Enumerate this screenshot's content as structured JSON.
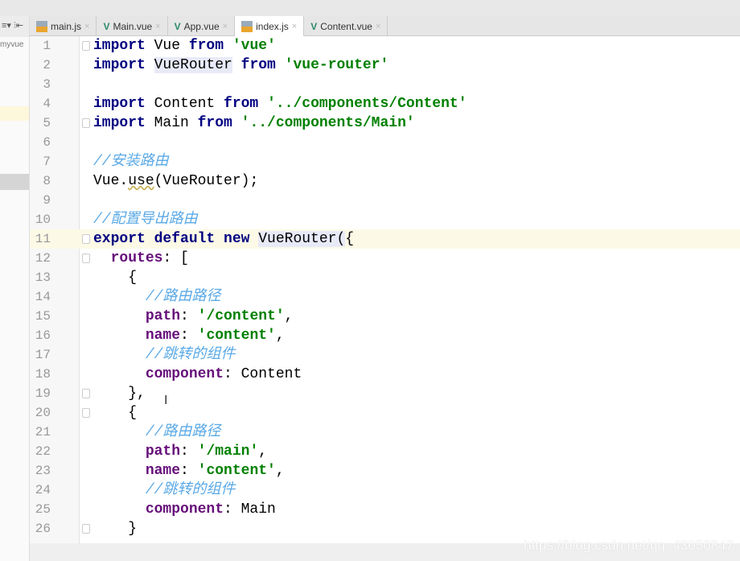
{
  "sidebar": {
    "toolbar": "≡▾ ⫶⇤",
    "project": "myvue"
  },
  "tabs": [
    {
      "label": "main.js",
      "icon": "js-file-icon",
      "active": false
    },
    {
      "label": "Main.vue",
      "icon": "vue-icon",
      "active": false
    },
    {
      "label": "App.vue",
      "icon": "vue-icon",
      "active": false
    },
    {
      "label": "index.js",
      "icon": "js-file-icon",
      "active": true
    },
    {
      "label": "Content.vue",
      "icon": "vue-icon",
      "active": false
    }
  ],
  "close_glyph": "×",
  "current_line": 11,
  "lines": [
    [
      [
        "kw",
        "import"
      ],
      [
        "t",
        " Vue "
      ],
      [
        "kw",
        "from"
      ],
      [
        "t",
        " "
      ],
      [
        "str",
        "'vue'"
      ]
    ],
    [
      [
        "kw",
        "import"
      ],
      [
        "t",
        " "
      ],
      [
        "hl",
        "VueRouter"
      ],
      [
        "t",
        " "
      ],
      [
        "kw",
        "from"
      ],
      [
        "t",
        " "
      ],
      [
        "str",
        "'vue-router'"
      ]
    ],
    [],
    [
      [
        "kw",
        "import"
      ],
      [
        "t",
        " Content "
      ],
      [
        "kw",
        "from"
      ],
      [
        "t",
        " "
      ],
      [
        "str",
        "'../components/Content'"
      ]
    ],
    [
      [
        "kw",
        "import"
      ],
      [
        "t",
        " Main "
      ],
      [
        "kw",
        "from"
      ],
      [
        "t",
        " "
      ],
      [
        "str",
        "'../components/Main'"
      ]
    ],
    [],
    [
      [
        "cm",
        "//安装路由"
      ]
    ],
    [
      [
        "t",
        "Vue."
      ],
      [
        "warn",
        "use"
      ],
      [
        "t",
        "(VueRouter);"
      ]
    ],
    [],
    [
      [
        "cm",
        "//配置导出路由"
      ]
    ],
    [
      [
        "kw",
        "export default new"
      ],
      [
        "t",
        " "
      ],
      [
        "hl",
        "VueRouter"
      ],
      [
        "hl",
        "("
      ],
      [
        "t",
        "{"
      ]
    ],
    [
      [
        "t",
        "  "
      ],
      [
        "prop",
        "routes"
      ],
      [
        "t",
        ": ["
      ]
    ],
    [
      [
        "t",
        "    {"
      ]
    ],
    [
      [
        "t",
        "      "
      ],
      [
        "cm",
        "//路由路径"
      ]
    ],
    [
      [
        "t",
        "      "
      ],
      [
        "prop",
        "path"
      ],
      [
        "t",
        ": "
      ],
      [
        "str",
        "'/content'"
      ],
      [
        "t",
        ","
      ]
    ],
    [
      [
        "t",
        "      "
      ],
      [
        "prop",
        "name"
      ],
      [
        "t",
        ": "
      ],
      [
        "str",
        "'content'"
      ],
      [
        "t",
        ","
      ]
    ],
    [
      [
        "t",
        "      "
      ],
      [
        "cm",
        "//跳转的组件"
      ]
    ],
    [
      [
        "t",
        "      "
      ],
      [
        "prop",
        "component"
      ],
      [
        "t",
        ": Content"
      ]
    ],
    [
      [
        "t",
        "    },"
      ]
    ],
    [
      [
        "t",
        "    {"
      ]
    ],
    [
      [
        "t",
        "      "
      ],
      [
        "cm",
        "//路由路径"
      ]
    ],
    [
      [
        "t",
        "      "
      ],
      [
        "prop",
        "path"
      ],
      [
        "t",
        ": "
      ],
      [
        "str",
        "'/main'"
      ],
      [
        "t",
        ","
      ]
    ],
    [
      [
        "t",
        "      "
      ],
      [
        "prop",
        "name"
      ],
      [
        "t",
        ": "
      ],
      [
        "str",
        "'content'"
      ],
      [
        "t",
        ","
      ]
    ],
    [
      [
        "t",
        "      "
      ],
      [
        "cm",
        "//跳转的组件"
      ]
    ],
    [
      [
        "t",
        "      "
      ],
      [
        "prop",
        "component"
      ],
      [
        "t",
        ": Main"
      ]
    ],
    [
      [
        "t",
        "    }"
      ]
    ]
  ],
  "fold_lines": [
    1,
    5,
    11,
    12,
    19,
    20,
    26
  ],
  "watermark": "https://blog.csdn.net/qq_43050847",
  "text_cursor": "I"
}
